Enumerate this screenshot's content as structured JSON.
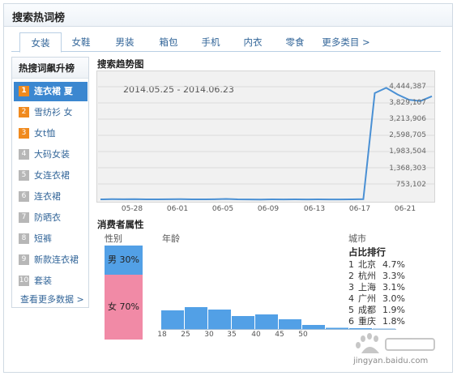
{
  "panel": {
    "title": "搜索热词榜"
  },
  "tabs": [
    "女装",
    "女鞋",
    "男装",
    "箱包",
    "手机",
    "内衣",
    "零食",
    "更多类目 >"
  ],
  "ranking": {
    "title": "热搜词飙升榜",
    "items": [
      {
        "num": "1",
        "label": "连衣裙 夏"
      },
      {
        "num": "2",
        "label": "雪纺衫 女"
      },
      {
        "num": "3",
        "label": "女t恤"
      },
      {
        "num": "4",
        "label": "大码女装"
      },
      {
        "num": "5",
        "label": "女连衣裙"
      },
      {
        "num": "6",
        "label": "连衣裙"
      },
      {
        "num": "7",
        "label": "防晒衣"
      },
      {
        "num": "8",
        "label": "短裤"
      },
      {
        "num": "9",
        "label": "新款连衣裙"
      },
      {
        "num": "10",
        "label": "套装"
      }
    ],
    "more_link": "查看更多数据 >"
  },
  "trend": {
    "title": "搜索趋势图",
    "date_range": "2014.05.25 - 2014.06.23"
  },
  "chart_data": [
    {
      "type": "line",
      "title": "搜索趋势图",
      "subtitle": "2014.05.25 - 2014.06.23",
      "x_tick_labels": [
        "05-28",
        "06-01",
        "06-05",
        "06-09",
        "06-13",
        "06-17",
        "06-21"
      ],
      "y_tick_labels": [
        "4,444,387",
        "3,829,107",
        "3,213,906",
        "2,598,705",
        "1,983,504",
        "1,368,303",
        "753,102"
      ],
      "ylim": [
        137901,
        4444387
      ],
      "x": [
        "05-25",
        "05-26",
        "05-27",
        "05-28",
        "05-29",
        "05-30",
        "05-31",
        "06-01",
        "06-02",
        "06-03",
        "06-04",
        "06-05",
        "06-06",
        "06-07",
        "06-08",
        "06-09",
        "06-10",
        "06-11",
        "06-12",
        "06-13",
        "06-14",
        "06-15",
        "06-16",
        "06-17",
        "06-18",
        "06-19",
        "06-20",
        "06-21",
        "06-22",
        "06-23"
      ],
      "series": [
        {
          "values": [
            170000,
            175000,
            172000,
            178000,
            170000,
            168000,
            172000,
            175000,
            170000,
            168000,
            172000,
            185000,
            170000,
            166000,
            164000,
            168000,
            166000,
            170000,
            166000,
            168000,
            165000,
            166000,
            168000,
            175000,
            4200000,
            4400000,
            4150000,
            3950000,
            3900000,
            4080000
          ]
        }
      ],
      "grid": true,
      "color": "#4a90d4"
    },
    {
      "type": "bar",
      "title": "年龄",
      "categories": [
        "18-25",
        "25-30",
        "30-35",
        "35-40",
        "40-45",
        "45-50",
        "50-55",
        "55-60",
        "60-65",
        "65-70"
      ],
      "x_tick_labels": [
        "18",
        "25",
        "30",
        "35",
        "40",
        "45",
        "50",
        "60"
      ],
      "values": [
        23,
        27,
        24,
        16,
        18,
        12,
        5,
        1.5,
        1,
        0.4
      ],
      "ylim": [
        0,
        30
      ],
      "color": "#52a0e6"
    }
  ],
  "consumer": {
    "title": "消费者属性",
    "gender_label": "性别",
    "age_label": "年龄",
    "city_label": "城市",
    "male": "男 30%",
    "female": "女 70%",
    "male_pct": 30,
    "female_pct": 70
  },
  "city": {
    "title": "占比排行",
    "rows": [
      {
        "rank": "1",
        "name": "北京",
        "pct": "4.7%"
      },
      {
        "rank": "2",
        "name": "杭州",
        "pct": "3.3%"
      },
      {
        "rank": "3",
        "name": "上海",
        "pct": "3.1%"
      },
      {
        "rank": "4",
        "name": "广州",
        "pct": "3.0%"
      },
      {
        "rank": "5",
        "name": "成都",
        "pct": "1.9%"
      },
      {
        "rank": "6",
        "name": "重庆",
        "pct": "1.8%"
      }
    ]
  },
  "watermark": {
    "text": "jingyan.baidu.com"
  },
  "colors": {
    "accent": "#3b87d0",
    "rank_highlight": "#f08a1e",
    "male": "#52a0e6",
    "female": "#f18aa6",
    "link": "#336699"
  }
}
